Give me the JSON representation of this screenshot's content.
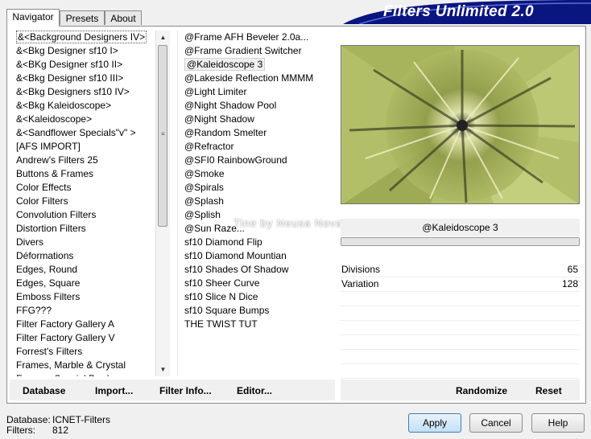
{
  "window": {
    "banner_title": "Filters Unlimited 2.0"
  },
  "tabs": [
    {
      "label": "Navigator",
      "active": true
    },
    {
      "label": "Presets",
      "active": false
    },
    {
      "label": "About",
      "active": false
    }
  ],
  "categories": [
    "&<Background Designers IV>",
    "&<Bkg Designer sf10 I>",
    "&<BKg Designer sf10 II>",
    "&<Bkg Designer sf10 III>",
    "&<Bkg Designers sf10 IV>",
    "&<Bkg Kaleidoscope>",
    "&<Kaleidoscope>",
    "&<Sandflower Specials\"v\" >",
    "[AFS IMPORT]",
    "Andrew's Filters 25",
    "Buttons & Frames",
    "Color Effects",
    "Color Filters",
    "Convolution Filters",
    "Distortion Filters",
    "Divers",
    "Déformations",
    "Edges, Round",
    "Edges, Square",
    "Emboss Filters",
    "FFG???",
    "Filter Factory Gallery A",
    "Filter Factory Gallery V",
    "Forrest's Filters",
    "Frames, Marble & Crystal",
    "Frames, Special Border..."
  ],
  "filters": [
    "@Frame AFH Beveler 2.0a...",
    "@Frame Gradient Switcher",
    "@Kaleidoscope 3",
    "@Lakeside Reflection MMMM",
    "@Light Limiter",
    "@Night Shadow Pool",
    "@Night Shadow",
    "@Random Smelter",
    "@Refractor",
    "@SFI0 RainbowGround",
    "@Smoke",
    "@Spirals",
    "@Splash",
    "@Splish",
    "@Sun Raze...",
    "sf10 Diamond Flip",
    "sf10 Diamond Mountian",
    "sf10 Shades Of Shadow",
    "sf10 Sheer Curve",
    "sf10 Slice N Dice",
    "sf10 Square Bumps",
    "THE TWIST TUT"
  ],
  "selected_filter": "@Kaleidoscope 3",
  "watermark": "Tine by Neusa Novaes",
  "params": [
    {
      "label": "Divisions",
      "value": "65"
    },
    {
      "label": "Variation",
      "value": "128"
    }
  ],
  "bottom_left_buttons": {
    "database": "Database",
    "import": "Import...",
    "filter_info": "Filter Info...",
    "editor": "Editor..."
  },
  "bottom_right_buttons": {
    "randomize": "Randomize",
    "reset": "Reset"
  },
  "status": {
    "database_label": "Database:",
    "database_value": "ICNET-Filters",
    "filters_label": "Filters:",
    "filters_value": "812"
  },
  "dialog_buttons": {
    "apply": "Apply",
    "cancel": "Cancel",
    "help": "Help"
  },
  "colors": {
    "banner": "#0a1580",
    "preview_green": "#b2bf68"
  }
}
